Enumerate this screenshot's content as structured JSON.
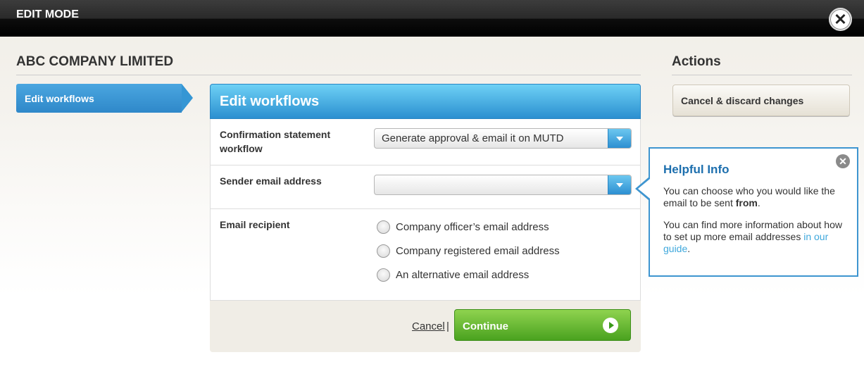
{
  "header": {
    "title": "EDIT MODE",
    "close_icon": "close-icon"
  },
  "company": {
    "name": "ABC COMPANY LIMITED"
  },
  "sidebar": {
    "items": [
      {
        "label": "Edit workflows",
        "active": true
      }
    ]
  },
  "panel": {
    "title": "Edit workflows",
    "fields": {
      "confirmation": {
        "label": "Confirmation statement workflow",
        "value": "Generate approval & email it on MUTD"
      },
      "sender": {
        "label": "Sender email address",
        "value": ""
      },
      "recipient": {
        "label": "Email recipient",
        "options": [
          {
            "label": "Company officer’s email address",
            "selected": false
          },
          {
            "label": "Company registered email address",
            "selected": false
          },
          {
            "label": "An alternative email address",
            "selected": false
          }
        ]
      }
    },
    "footer": {
      "cancel_label": "Cancel",
      "separator": "|",
      "continue_label": "Continue"
    }
  },
  "actions": {
    "title": "Actions",
    "cancel_discard_label": "Cancel & discard changes"
  },
  "helpful_info": {
    "title": "Helpful Info",
    "para1_prefix": "You can choose who you would like the email to be sent ",
    "para1_bold": "from",
    "para1_suffix": ".",
    "para2_prefix": "You can find more information about how to set up more email addresses ",
    "para2_link": "in our guide",
    "para2_suffix": "."
  },
  "colors": {
    "accent_blue": "#2f88c9",
    "continue_green": "#4aa21f",
    "link": "#3fa8dc"
  }
}
